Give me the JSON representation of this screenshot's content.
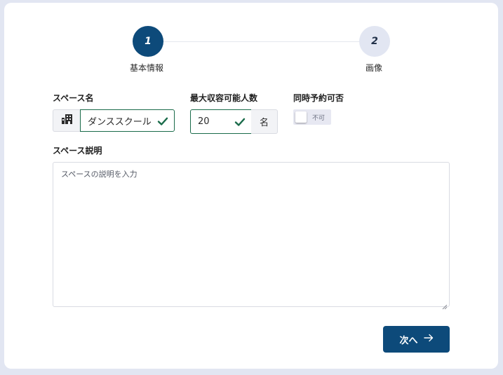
{
  "stepper": {
    "steps": [
      {
        "number": "1",
        "label": "基本情報",
        "state": "active"
      },
      {
        "number": "2",
        "label": "画像",
        "state": "inactive"
      }
    ]
  },
  "form": {
    "space_name": {
      "label": "スペース名",
      "value": "ダンススクール",
      "prefix_icon": "building-icon",
      "state": "valid"
    },
    "capacity": {
      "label": "最大収容可能人数",
      "value": "20",
      "suffix": "名",
      "state": "valid"
    },
    "concurrent_booking": {
      "label": "同時予約可否",
      "toggle_text": "不可",
      "checked": false
    },
    "description": {
      "label": "スペース説明",
      "placeholder": "スペースの説明を入力"
    }
  },
  "actions": {
    "next_label": "次へ",
    "next_icon": "arrow-right-icon"
  },
  "colors": {
    "primary": "#0d4a7a",
    "valid": "#1a6b4a",
    "page_bg": "#e2e6f2",
    "step_inactive_bg": "#e2e6f2"
  }
}
